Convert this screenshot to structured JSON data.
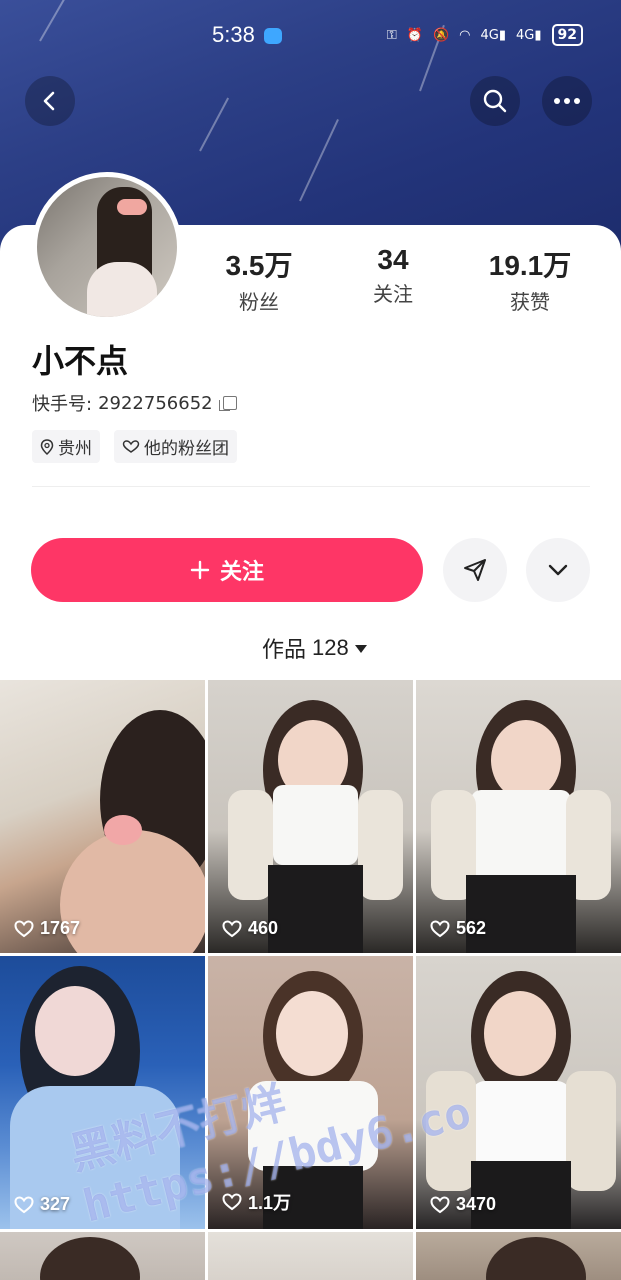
{
  "status_bar": {
    "time": "5:38",
    "signal_1": "4G",
    "signal_2": "4G",
    "battery": "92"
  },
  "profile": {
    "name": "小不点",
    "uid_label": "快手号:",
    "uid_value": "2922756652",
    "stats": [
      {
        "num": "3.5万",
        "label": "粉丝"
      },
      {
        "num": "34",
        "label": "关注"
      },
      {
        "num": "19.1万",
        "label": "获赞"
      }
    ],
    "tags": [
      {
        "icon": "location-pin-icon",
        "label": "贵州"
      },
      {
        "icon": "heart-outline-icon",
        "label": "他的粉丝团"
      }
    ]
  },
  "actions": {
    "follow_label": "关注"
  },
  "works_tab": {
    "label": "作品",
    "count": "128"
  },
  "works": [
    {
      "likes": "1767"
    },
    {
      "likes": "460"
    },
    {
      "likes": "562"
    },
    {
      "likes": "327"
    },
    {
      "likes": "1.1万"
    },
    {
      "likes": "3470"
    }
  ],
  "watermark": {
    "line1": "黑料不打烊",
    "line2": "https://bdy6.co"
  },
  "colors": {
    "accent": "#fe3666",
    "banner": "#2c3f86"
  }
}
